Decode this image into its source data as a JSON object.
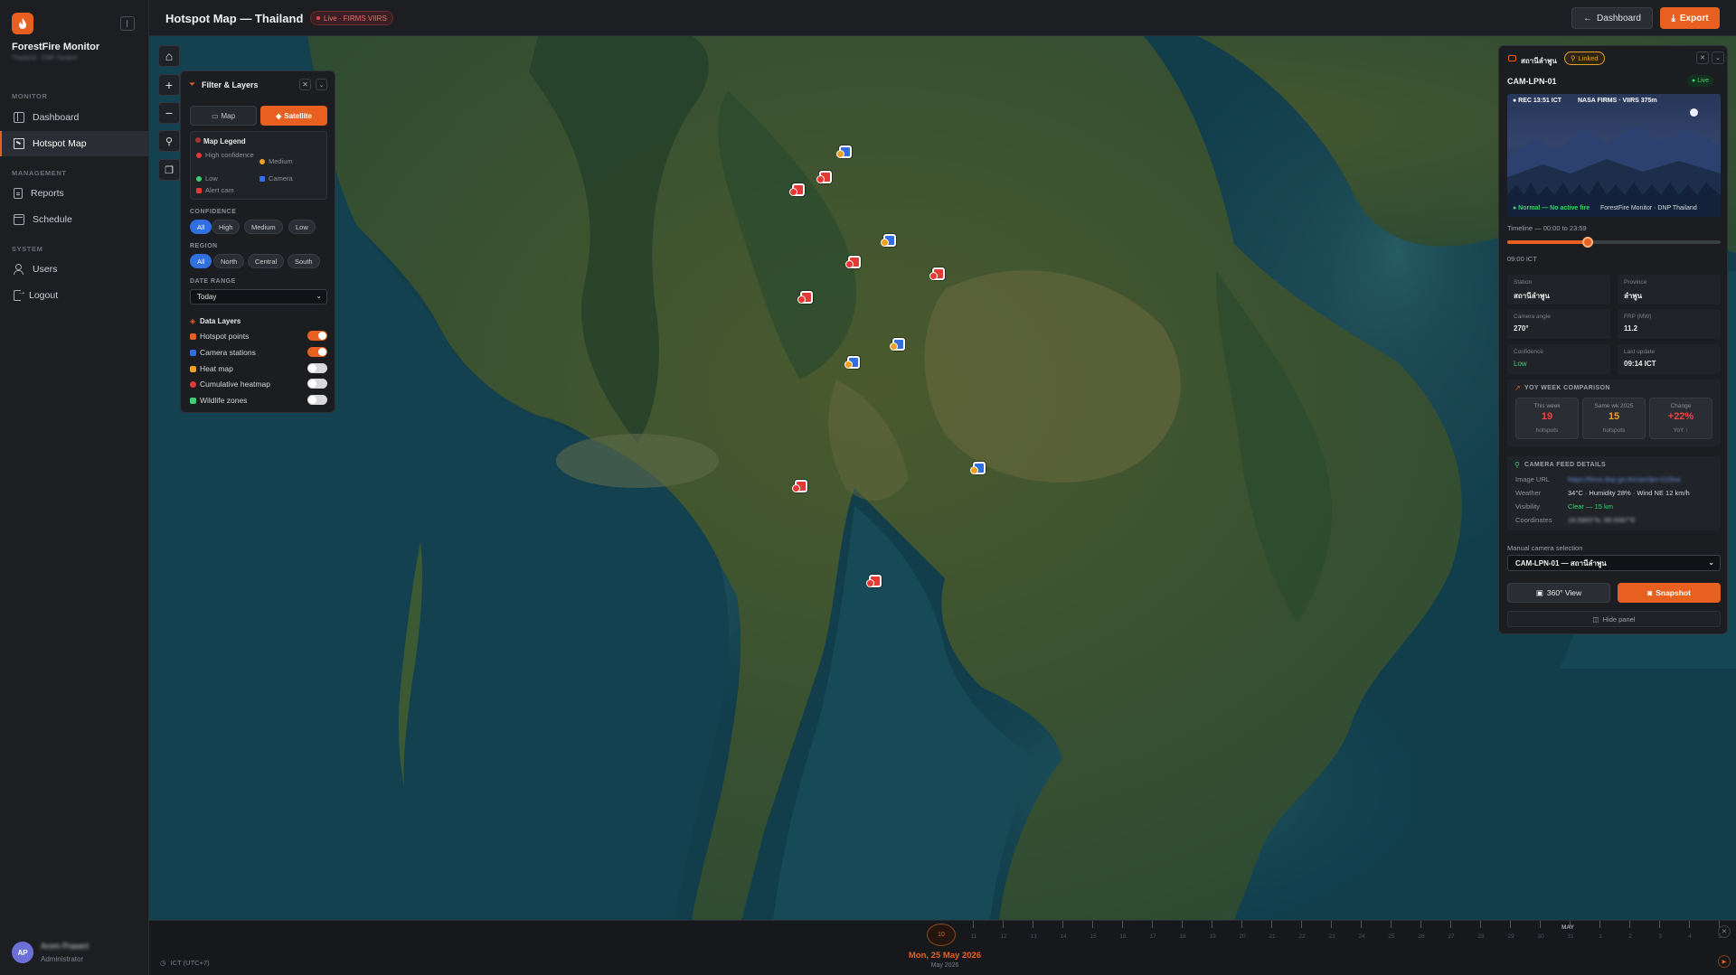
{
  "sidebar": {
    "brand": "ForestFire Monitor",
    "brand_sub": "Thailand · DNP System",
    "sections": {
      "monitor": "MONITOR",
      "management": "MANAGEMENT",
      "system": "SYSTEM"
    },
    "items": [
      {
        "label": "Dashboard",
        "icon": "grid-icon"
      },
      {
        "label": "Hotspot Map",
        "icon": "map-icon",
        "active": true
      },
      {
        "label": "Reports",
        "icon": "document-icon"
      },
      {
        "label": "Schedule",
        "icon": "calendar-icon"
      },
      {
        "label": "Users",
        "icon": "users-icon"
      },
      {
        "label": "Logout",
        "icon": "logout-icon"
      }
    ],
    "user": {
      "initials": "AP",
      "name": "Arom Prasert",
      "role": "Administrator"
    }
  },
  "topbar": {
    "title": "Hotspot Map — Thailand",
    "live_badge": "Live · FIRMS VIIRS",
    "dashboard_label": "Dashboard",
    "export_label": "Export"
  },
  "filter": {
    "title": "Filter & Layers",
    "view_map": "Map",
    "view_satellite": "Satellite",
    "legend_title": "Map Legend",
    "legend": [
      {
        "label": "High confidence",
        "color": "#e53935"
      },
      {
        "label": "Medium",
        "color": "#f0a020"
      },
      {
        "label": "Low",
        "color": "#3ccf6f"
      },
      {
        "label": "Camera",
        "color": "#2f6fe0"
      },
      {
        "label": "Alert cam",
        "color": "#e53935"
      }
    ],
    "confidence_label": "CONFIDENCE",
    "confidence": [
      "All",
      "High",
      "Medium",
      "Low"
    ],
    "region_label": "REGION",
    "region": [
      "All",
      "North",
      "Central",
      "South"
    ],
    "date_range_label": "DATE RANGE",
    "date_range_value": "Today",
    "layers_title": "Data Layers",
    "layers": [
      {
        "label": "Hotspot points",
        "color": "#e8601f",
        "on": true
      },
      {
        "label": "Camera stations",
        "color": "#2f6fe0",
        "on": true
      },
      {
        "label": "Heat map",
        "color": "#f0a020",
        "on": false
      },
      {
        "label": "Cumulative heatmap",
        "color": "#e53935",
        "on": false
      },
      {
        "label": "Wildlife zones",
        "color": "#3ccf6f",
        "on": false
      }
    ]
  },
  "camera": {
    "header_station": "สถานีลำพูน",
    "linked": "Linked",
    "id": "CAM-LPN-01",
    "live": "Live",
    "feed_rec": "● REC 13:51 ICT",
    "feed_source": "NASA FIRMS · VIIRS 375m",
    "feed_status": "● Normal — No active fire",
    "feed_owner": "ForestFire Monitor · DNP Thailand",
    "timeline_label": "Timeline — 00:00 to 23:59",
    "timeline_fraction": 0.375,
    "timeline_time": "09:00 ICT",
    "info": [
      {
        "k": "Station",
        "v": "สถานีลำพูน"
      },
      {
        "k": "Province",
        "v": "ลำพูน"
      },
      {
        "k": "Camera angle",
        "v": "270°"
      },
      {
        "k": "FRP (MW)",
        "v": "11.2"
      },
      {
        "k": "Confidence",
        "v": "Low"
      },
      {
        "k": "Last update",
        "v": "09:14 ICT"
      }
    ],
    "yoy_title": "YOY WEEK COMPARISON",
    "yoy": [
      {
        "k": "This week",
        "v": "19",
        "s": "hotspots",
        "color": "#ef4444"
      },
      {
        "k": "Same wk 2025",
        "v": "15",
        "s": "hotspots",
        "color": "#f0a020"
      },
      {
        "k": "Change",
        "v": "+22%",
        "s": "YoY ↑",
        "color": "#ef4444"
      }
    ],
    "feed_details_title": "CAMERA FEED DETAILS",
    "feed_details": [
      {
        "k": "Image URL",
        "v": "https://firms.dnp.go.th/cam/lpn-01/live"
      },
      {
        "k": "Weather",
        "v": "34°C · Humidity 28% · Wind NE 12 km/h"
      },
      {
        "k": "Visibility",
        "v": "Clear — 15 km"
      },
      {
        "k": "Coordinates",
        "v": "18.5800°N, 99.0087°E"
      }
    ],
    "manual_label": "Manual camera selection",
    "manual_value": "CAM-LPN-01 — สถานีลำพูน",
    "btn_360": "360° View",
    "btn_snapshot": "Snapshot",
    "btn_hide": "Hide panel"
  },
  "timeline": {
    "current_day": "10",
    "date": "Mon, 25 May 2026",
    "month": "May 2026",
    "may_label": "MAY",
    "timezone": "ICT (UTC+7)",
    "ticks": [
      "11",
      "12",
      "13",
      "14",
      "15",
      "16",
      "17",
      "18",
      "19",
      "20",
      "21",
      "22",
      "23",
      "24",
      "25",
      "26",
      "27",
      "28",
      "29",
      "30",
      "31",
      "1",
      "2",
      "3",
      "4",
      "5"
    ]
  }
}
